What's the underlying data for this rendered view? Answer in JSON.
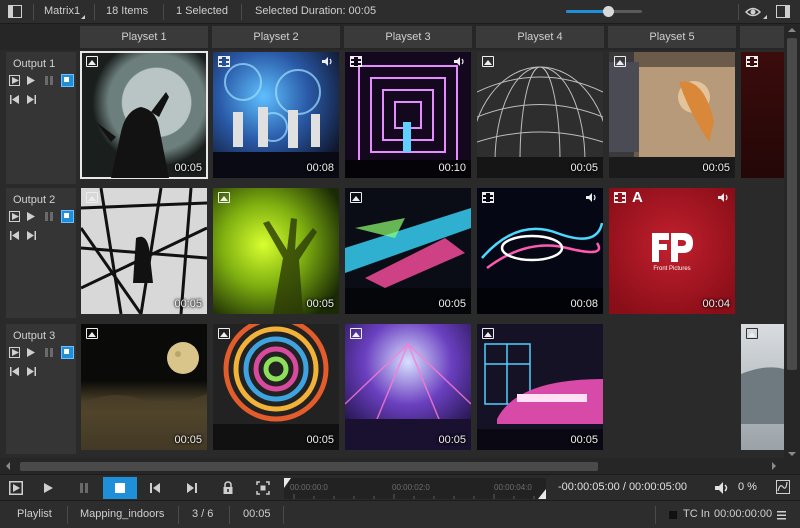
{
  "topbar": {
    "matrix_name": "Matrix1",
    "items_count": "18 Items",
    "selected_count": "1 Selected",
    "selected_duration": "Selected Duration: 00:05",
    "zoom_level": 0.55
  },
  "columns": [
    "Playset 1",
    "Playset 2",
    "Playset 3",
    "Playset 4",
    "Playset 5"
  ],
  "rows": [
    {
      "label": "Output 1",
      "cells": [
        {
          "type": "image",
          "audio": false,
          "duration": "00:05",
          "selected": true
        },
        {
          "type": "video",
          "audio": true,
          "duration": "00:08",
          "selected": false
        },
        {
          "type": "video",
          "audio": true,
          "duration": "00:10",
          "selected": false
        },
        {
          "type": "image",
          "audio": false,
          "duration": "00:05",
          "selected": false
        },
        {
          "type": "image",
          "audio": false,
          "duration": "00:05",
          "selected": false
        },
        {
          "type": "video",
          "audio": false,
          "duration": "",
          "selected": false
        }
      ]
    },
    {
      "label": "Output 2",
      "cells": [
        {
          "type": "image",
          "audio": false,
          "duration": "00:05",
          "selected": false
        },
        {
          "type": "image",
          "audio": false,
          "duration": "00:05",
          "selected": false
        },
        {
          "type": "image",
          "audio": false,
          "duration": "00:05",
          "selected": false
        },
        {
          "type": "video",
          "audio": true,
          "duration": "00:08",
          "selected": false
        },
        {
          "type": "video",
          "audio": true,
          "duration": "00:04",
          "selected": false,
          "badge": "A",
          "logo_text": "Front Pictures"
        }
      ]
    },
    {
      "label": "Output 3",
      "cells": [
        {
          "type": "image",
          "audio": false,
          "duration": "00:05",
          "selected": false
        },
        {
          "type": "image",
          "audio": false,
          "duration": "00:05",
          "selected": false
        },
        {
          "type": "image",
          "audio": false,
          "duration": "00:05",
          "selected": false
        },
        {
          "type": "image",
          "audio": false,
          "duration": "00:05",
          "selected": false
        },
        {
          "type": "empty"
        },
        {
          "type": "image",
          "audio": false,
          "duration": "",
          "selected": false
        }
      ]
    }
  ],
  "transport": {
    "timeline_marks": [
      "00:00:00:0",
      "00:00:02:0",
      "00:00:04:0"
    ],
    "timecode": "-00:00:05:00 / 00:00:05:00",
    "volume": "0 %"
  },
  "statusbar": {
    "mode": "Playlist",
    "project": "Mapping_indoors",
    "position": "3 / 6",
    "duration": "00:05",
    "tc_label": "TC In",
    "tc_value": "00:00:00:00"
  },
  "colors": {
    "accent": "#1e8fd8",
    "background": "#2b2b2b",
    "panel": "#353535"
  }
}
